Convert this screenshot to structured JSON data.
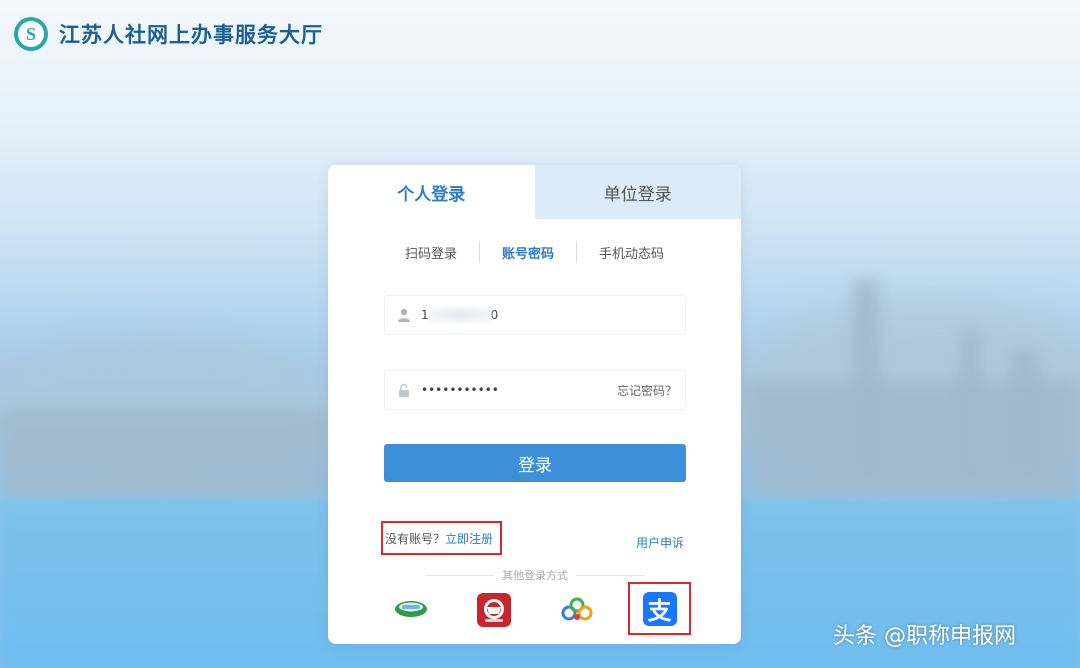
{
  "site": {
    "title": "江苏人社网上办事服务大厅"
  },
  "tabs": [
    {
      "label": "个人登录",
      "active": true
    },
    {
      "label": "单位登录",
      "active": false
    }
  ],
  "subtabs": [
    {
      "label": "扫码登录",
      "active": false
    },
    {
      "label": "账号密码",
      "active": true
    },
    {
      "label": "手机动态码",
      "active": false
    }
  ],
  "account": {
    "prefix": "1",
    "suffix": "0",
    "icon": "user-icon"
  },
  "password": {
    "value": "•••••••••••",
    "icon": "lock-icon",
    "forgot": "忘记密码？"
  },
  "login_button": "登录",
  "register": {
    "question": "没有账号？",
    "link": "立即注册"
  },
  "appeal": "用户申诉",
  "other_login_label": "其他登录方式",
  "social_logins": [
    {
      "icon": "jiangsu-zhengfu-icon"
    },
    {
      "icon": "shebao-card-icon"
    },
    {
      "icon": "colorful-logo-icon"
    },
    {
      "icon": "alipay-icon",
      "glyph": "支"
    }
  ],
  "watermark": "头条 @职称申报网",
  "colors": {
    "accent": "#2f7cc6",
    "button": "#3d8fd8",
    "highlight": "#e0252b",
    "brand": "#2aa8a3"
  }
}
